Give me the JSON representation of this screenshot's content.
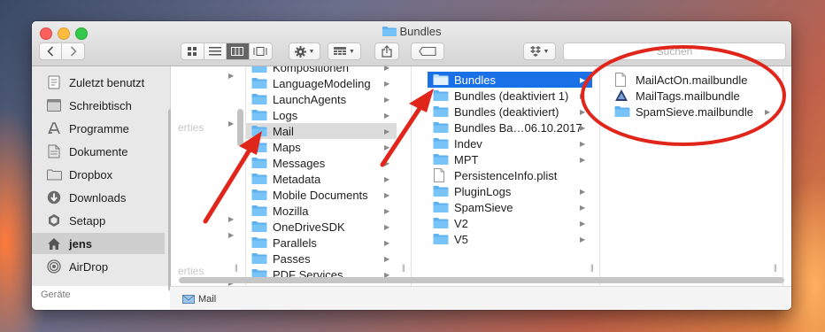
{
  "window": {
    "title": "Bundles"
  },
  "toolbar": {
    "back_icon": "chevron-left-icon",
    "forward_icon": "chevron-right-icon",
    "view_modes": [
      "icon-view",
      "list-view",
      "column-view",
      "gallery-view"
    ],
    "active_view": "column-view",
    "action_icon": "gear-icon",
    "arrange_icon": "arrange-icon",
    "share_icon": "share-icon",
    "tag_icon": "tag-icon",
    "dropbox_icon": "dropbox-icon",
    "search_placeholder": "Suchen"
  },
  "sidebar": {
    "items": [
      {
        "label": "Zuletzt benutzt",
        "icon": "recents-icon"
      },
      {
        "label": "Schreibtisch",
        "icon": "desktop-icon"
      },
      {
        "label": "Programme",
        "icon": "applications-icon"
      },
      {
        "label": "Dokumente",
        "icon": "documents-icon"
      },
      {
        "label": "Dropbox",
        "icon": "folder-icon"
      },
      {
        "label": "Downloads",
        "icon": "downloads-icon"
      },
      {
        "label": "Setapp",
        "icon": "setapp-icon"
      },
      {
        "label": "jens",
        "icon": "home-icon",
        "selected": true
      },
      {
        "label": "AirDrop",
        "icon": "airdrop-icon"
      }
    ],
    "section_heading": "Geräte"
  },
  "columns": {
    "col0_ghost": [
      "erties",
      "erties"
    ],
    "col1": [
      "Kompositionen",
      "LanguageModeling",
      "LaunchAgents",
      "Logs",
      "Mail",
      "Maps",
      "Messages",
      "Metadata",
      "Mobile Documents",
      "Mozilla",
      "OneDriveSDK",
      "Parallels",
      "Passes",
      "PDF Services"
    ],
    "col1_selected": "Mail",
    "col2": [
      {
        "label": "Bundles",
        "kind": "folder"
      },
      {
        "label": "Bundles (deaktiviert 1)",
        "kind": "folder"
      },
      {
        "label": "Bundles (deaktiviert)",
        "kind": "folder"
      },
      {
        "label": "Bundles Ba…06.10.2017",
        "kind": "folder"
      },
      {
        "label": "Indev",
        "kind": "folder"
      },
      {
        "label": "MPT",
        "kind": "folder"
      },
      {
        "label": "PersistenceInfo.plist",
        "kind": "file"
      },
      {
        "label": "PluginLogs",
        "kind": "folder"
      },
      {
        "label": "SpamSieve",
        "kind": "folder"
      },
      {
        "label": "V2",
        "kind": "folder"
      },
      {
        "label": "V5",
        "kind": "folder"
      }
    ],
    "col2_selected": "Bundles",
    "col3": [
      {
        "label": "MailActOn.mailbundle",
        "kind": "file"
      },
      {
        "label": "MailTags.mailbundle",
        "kind": "bundle"
      },
      {
        "label": "SpamSieve.mailbundle",
        "kind": "folder"
      }
    ]
  },
  "pathbar": {
    "label": "Mail",
    "icon": "mail-icon"
  },
  "colors": {
    "selection": "#1a70e6",
    "folder": "#5fb2ef",
    "annotation": "#e0251b"
  }
}
